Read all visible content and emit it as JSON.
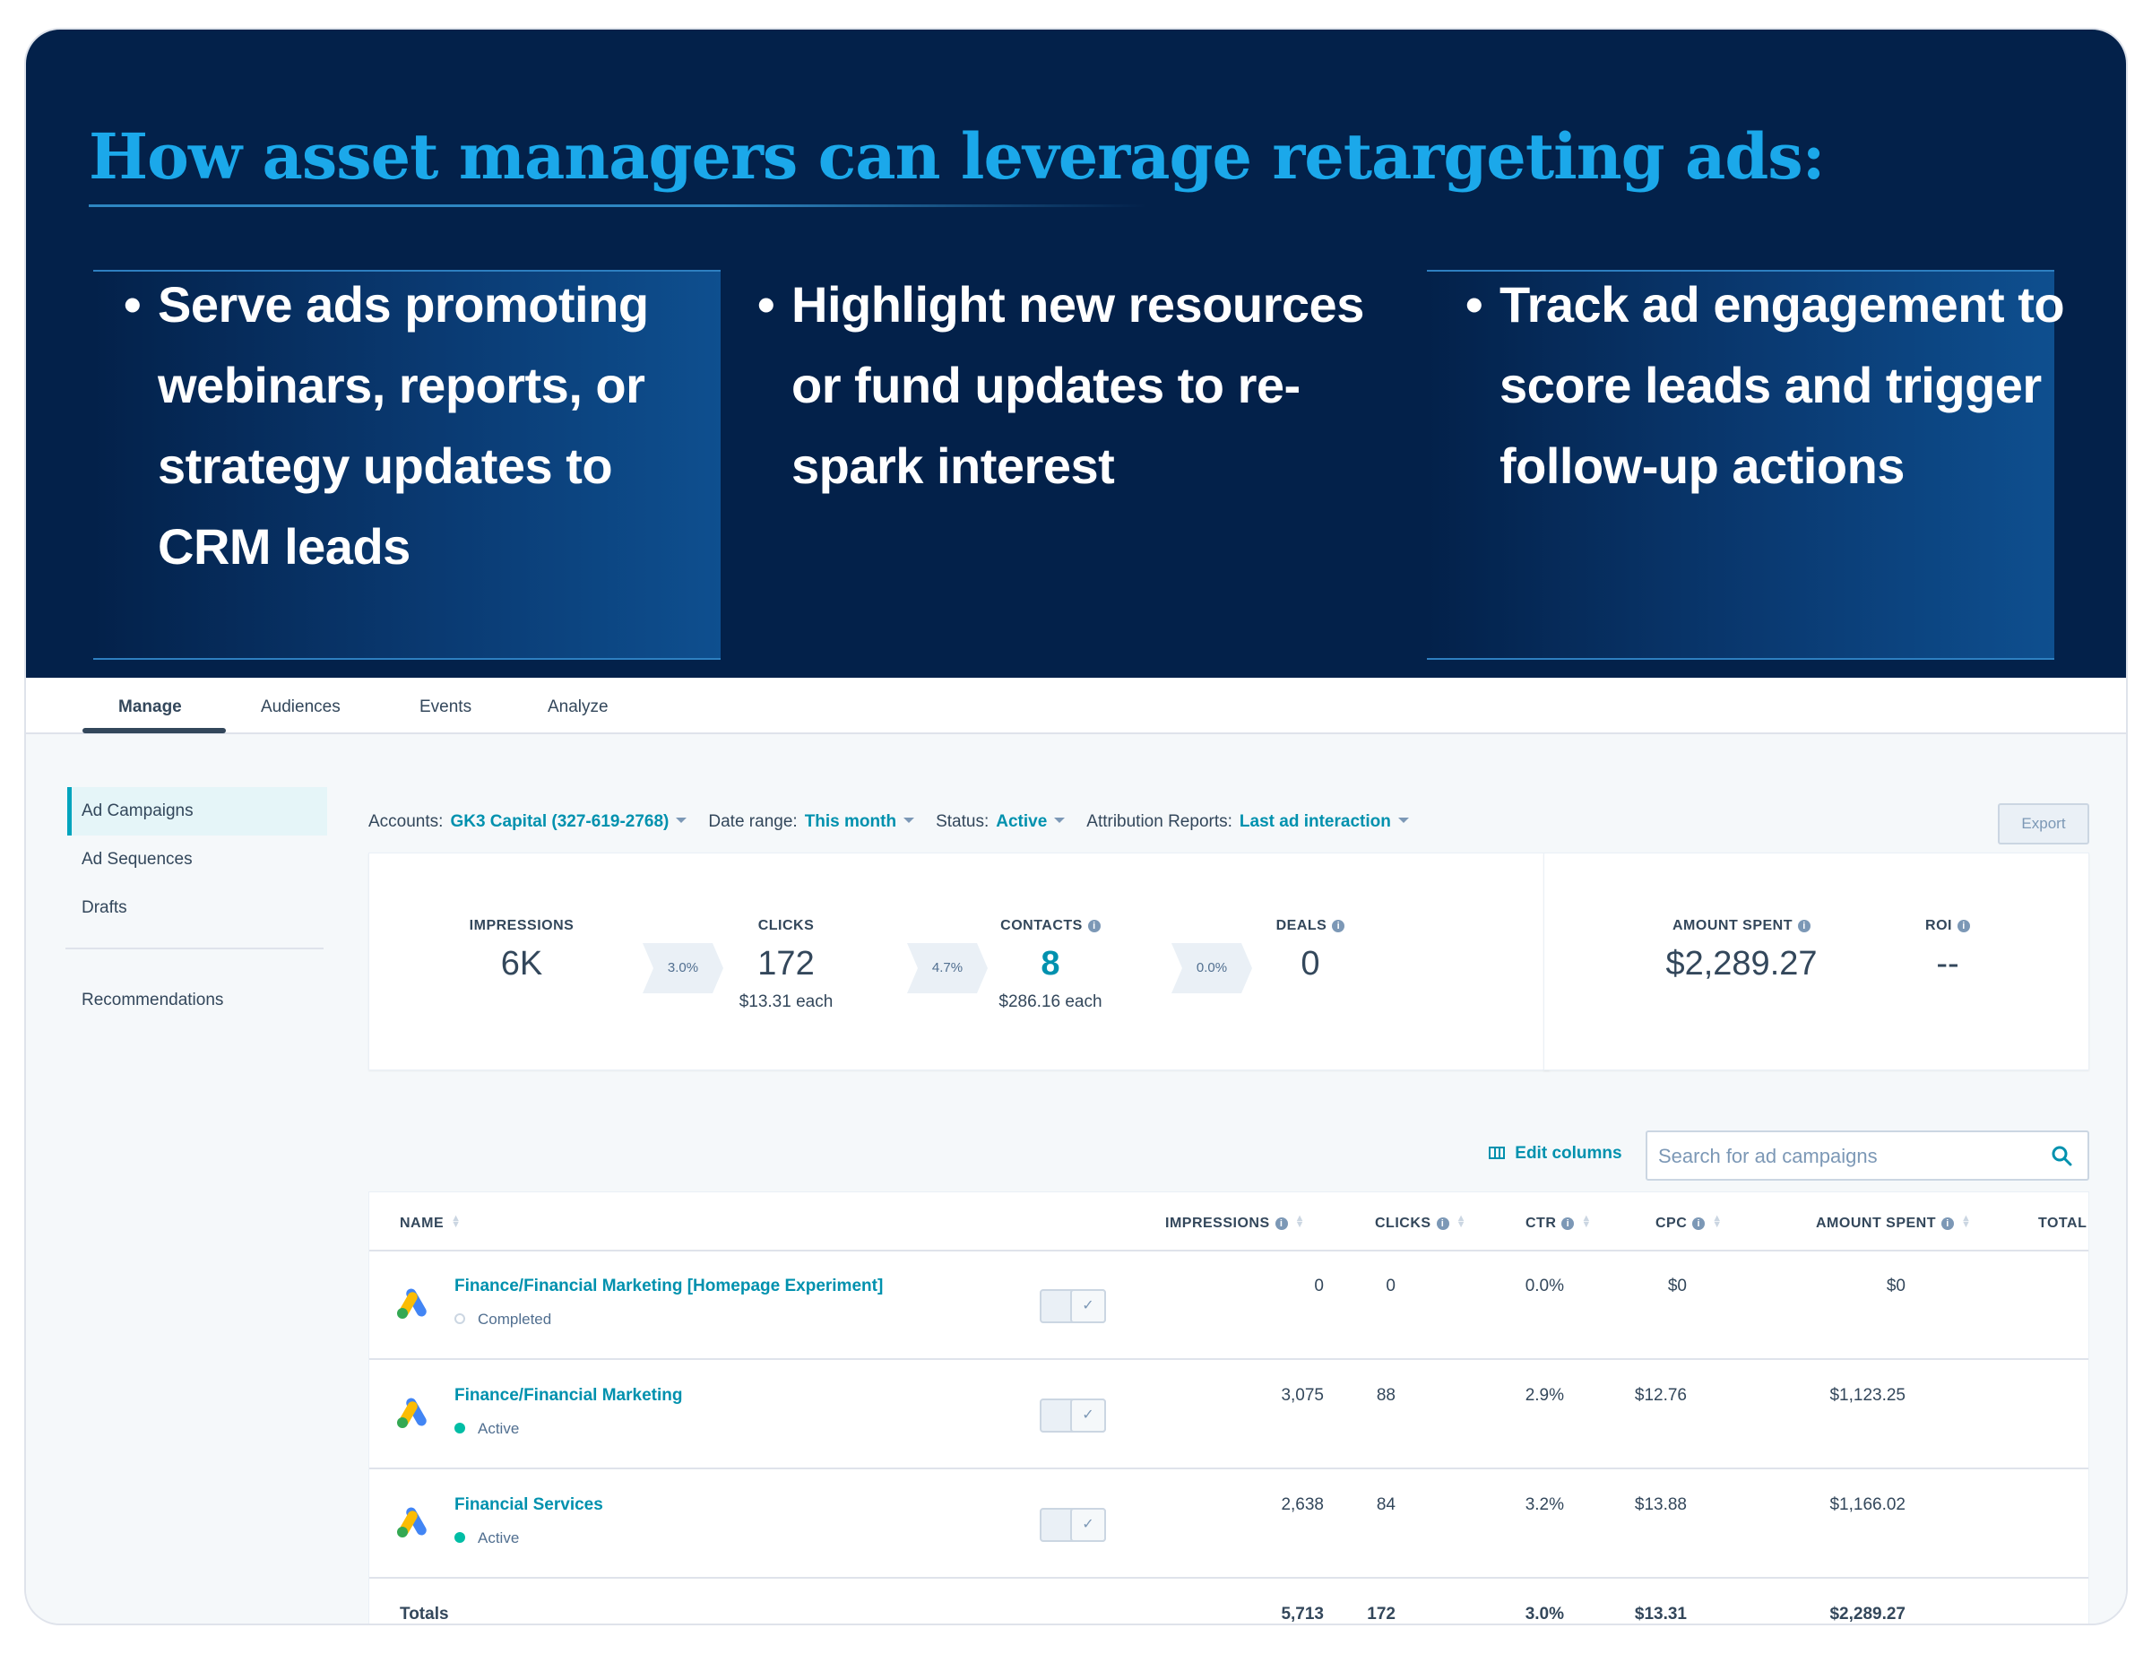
{
  "hero": {
    "title": "How asset managers can leverage retargeting ads:",
    "bullets": [
      "Serve ads promoting webinars, reports, or strategy updates to CRM leads",
      "Highlight new resources or fund updates to re-spark interest",
      "Track ad engagement to score leads and trigger follow-up actions"
    ]
  },
  "tabs": [
    "Manage",
    "Audiences",
    "Events",
    "Analyze"
  ],
  "active_tab": "Manage",
  "sidebar": {
    "items": [
      "Ad Campaigns",
      "Ad Sequences",
      "Drafts",
      "Recommendations"
    ],
    "active": "Ad Campaigns"
  },
  "filters": {
    "accounts_label": "Accounts:",
    "accounts_value": "GK3 Capital (327-619-2768)",
    "date_label": "Date range:",
    "date_value": "This month",
    "status_label": "Status:",
    "status_value": "Active",
    "attribution_label": "Attribution Reports:",
    "attribution_value": "Last ad interaction"
  },
  "export_label": "Export",
  "funnel": {
    "impressions": {
      "label": "IMPRESSIONS",
      "value": "6K"
    },
    "rate1": "3.0%",
    "clicks": {
      "label": "CLICKS",
      "value": "172",
      "sub": "$13.31 each"
    },
    "rate2": "4.7%",
    "contacts": {
      "label": "CONTACTS",
      "value": "8",
      "sub": "$286.16 each"
    },
    "rate3": "0.0%",
    "deals": {
      "label": "DEALS",
      "value": "0"
    }
  },
  "spend": {
    "amount_label": "AMOUNT SPENT",
    "amount_value": "$2,289.27",
    "roi_label": "ROI",
    "roi_value": "--"
  },
  "edit_columns_label": "Edit columns",
  "search": {
    "placeholder": "Search for ad campaigns"
  },
  "table": {
    "headers": [
      "NAME",
      "IMPRESSIONS",
      "CLICKS",
      "CTR",
      "CPC",
      "AMOUNT SPENT",
      "TOTAL CO"
    ],
    "rows": [
      {
        "name": "Finance/Financial Marketing [Homepage Experiment]",
        "status": "Completed",
        "impressions": "0",
        "clicks": "0",
        "ctr": "0.0%",
        "cpc": "$0",
        "amount": "$0"
      },
      {
        "name": "Finance/Financial Marketing",
        "status": "Active",
        "impressions": "3,075",
        "clicks": "88",
        "ctr": "2.9%",
        "cpc": "$12.76",
        "amount": "$1,123.25"
      },
      {
        "name": "Financial Services",
        "status": "Active",
        "impressions": "2,638",
        "clicks": "84",
        "ctr": "3.2%",
        "cpc": "$13.88",
        "amount": "$1,166.02"
      }
    ],
    "totals": {
      "label": "Totals",
      "impressions": "5,713",
      "clicks": "172",
      "ctr": "3.0%",
      "cpc": "$13.31",
      "amount": "$2,289.27"
    }
  },
  "colors": {
    "hero_bg": "#03214a",
    "title_blue": "#1ba8ea",
    "link_teal": "#0091ae",
    "text_dark": "#33475b",
    "status_active": "#00bda5"
  },
  "icons": {
    "info": "info-icon",
    "sort": "sort-icon",
    "search": "search-icon",
    "edit_columns": "columns-icon",
    "campaign": "google-ads-icon"
  }
}
